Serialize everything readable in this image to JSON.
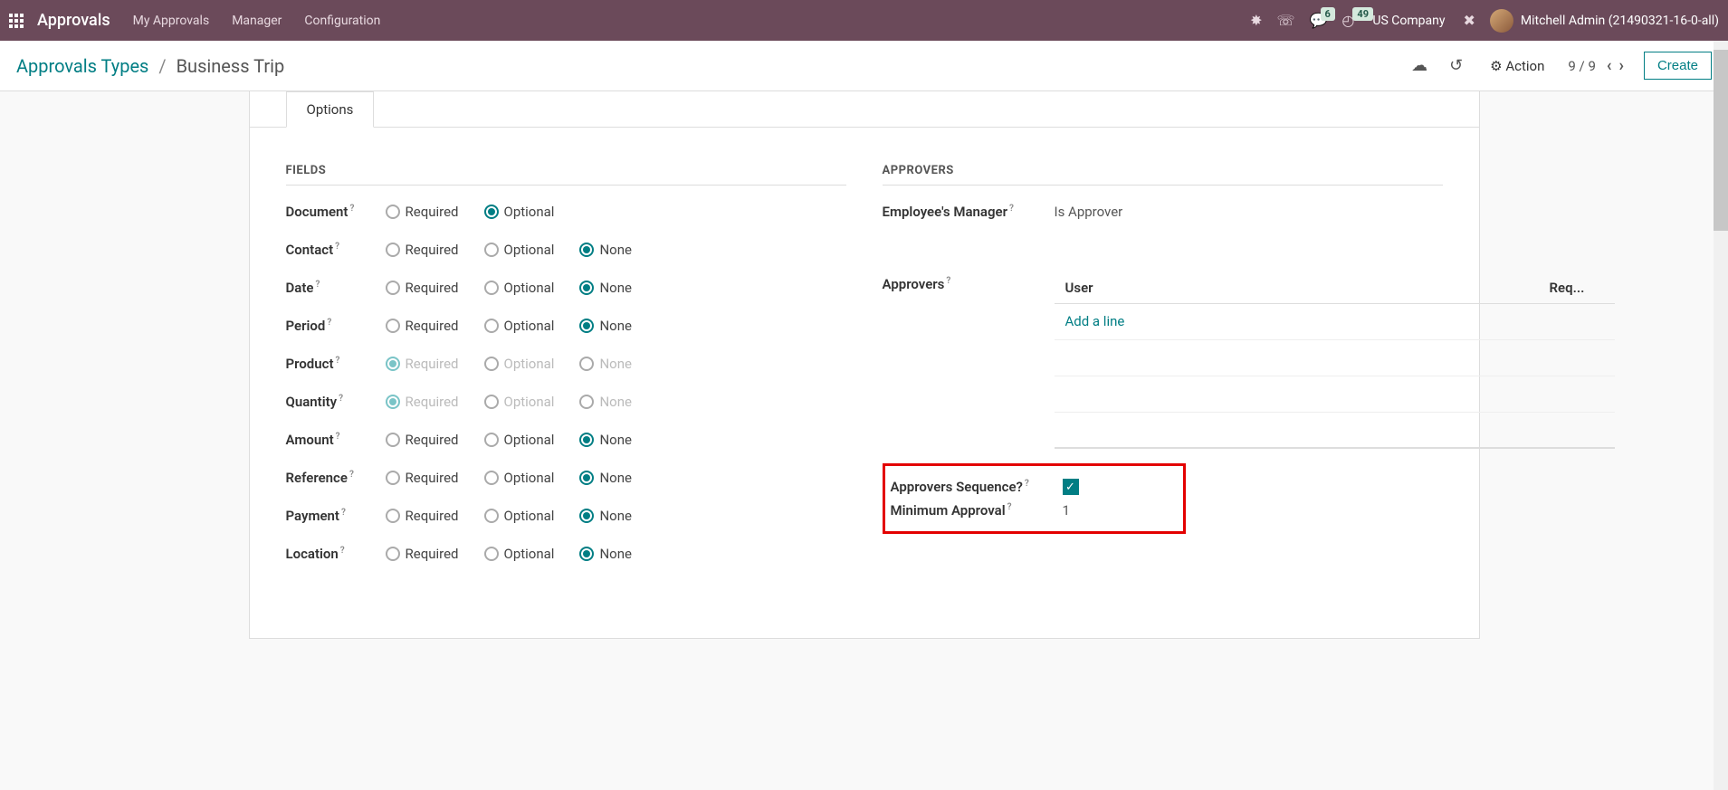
{
  "topnav": {
    "brand": "Approvals",
    "menu": [
      "My Approvals",
      "Manager",
      "Configuration"
    ],
    "badge_chat": "6",
    "badge_clock": "49",
    "company": "US Company",
    "username": "Mitchell Admin (21490321-16-0-all)"
  },
  "actionbar": {
    "breadcrumb_root": "Approvals Types",
    "breadcrumb_current": "Business Trip",
    "action_label": "Action",
    "pager_cur": "9",
    "pager_total": "9",
    "create_label": "Create"
  },
  "tabs": {
    "options": "Options"
  },
  "fields": {
    "title": "FIELDS",
    "radio_required": "Required",
    "radio_optional": "Optional",
    "radio_none": "None",
    "rows": [
      {
        "label": "Document",
        "options": [
          "Required",
          "Optional"
        ],
        "selected": "Optional",
        "disabled": false
      },
      {
        "label": "Contact",
        "options": [
          "Required",
          "Optional",
          "None"
        ],
        "selected": "None",
        "disabled": false
      },
      {
        "label": "Date",
        "options": [
          "Required",
          "Optional",
          "None"
        ],
        "selected": "None",
        "disabled": false
      },
      {
        "label": "Period",
        "options": [
          "Required",
          "Optional",
          "None"
        ],
        "selected": "None",
        "disabled": false
      },
      {
        "label": "Product",
        "options": [
          "Required",
          "Optional",
          "None"
        ],
        "selected": "Required",
        "disabled": true
      },
      {
        "label": "Quantity",
        "options": [
          "Required",
          "Optional",
          "None"
        ],
        "selected": "Required",
        "disabled": true
      },
      {
        "label": "Amount",
        "options": [
          "Required",
          "Optional",
          "None"
        ],
        "selected": "None",
        "disabled": false
      },
      {
        "label": "Reference",
        "options": [
          "Required",
          "Optional",
          "None"
        ],
        "selected": "None",
        "disabled": false
      },
      {
        "label": "Payment",
        "options": [
          "Required",
          "Optional",
          "None"
        ],
        "selected": "None",
        "disabled": false
      },
      {
        "label": "Location",
        "options": [
          "Required",
          "Optional",
          "None"
        ],
        "selected": "None",
        "disabled": false
      }
    ]
  },
  "approvers": {
    "title": "APPROVERS",
    "manager_label": "Employee's Manager",
    "manager_value": "Is Approver",
    "approvers_label": "Approvers",
    "table_user": "User",
    "table_req": "Req...",
    "add_line": "Add a line",
    "seq_label": "Approvers Sequence?",
    "seq_checked": true,
    "min_label": "Minimum Approval",
    "min_value": "1"
  }
}
